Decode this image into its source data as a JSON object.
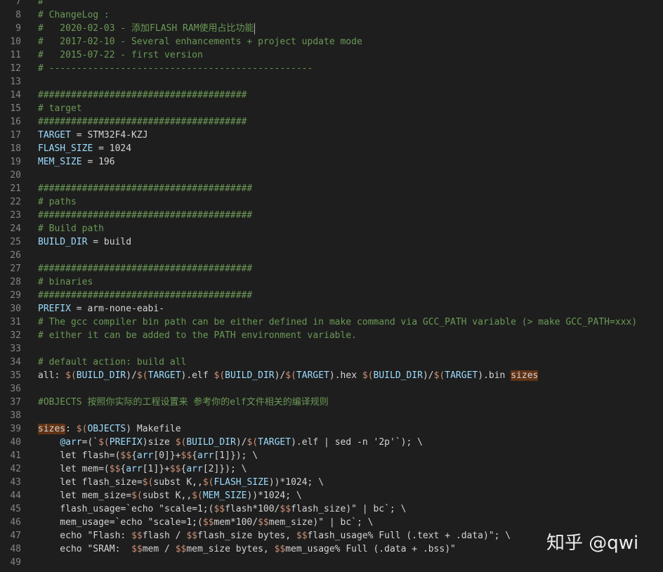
{
  "watermark": "知乎 @qwi",
  "lines": [
    {
      "n": "7",
      "segs": [
        [
          "#",
          "c"
        ]
      ]
    },
    {
      "n": "8",
      "segs": [
        [
          "# ChangeLog :",
          "c"
        ]
      ]
    },
    {
      "n": "9",
      "segs": [
        [
          "#   2020-02-03 - 添加FLASH RAM使用占比功能",
          "c"
        ]
      ],
      "cursor": true
    },
    {
      "n": "10",
      "segs": [
        [
          "#   2017-02-10 - Several enhancements + project update mode",
          "c"
        ]
      ]
    },
    {
      "n": "11",
      "segs": [
        [
          "#   2015-07-22 - first version",
          "c"
        ]
      ]
    },
    {
      "n": "12",
      "segs": [
        [
          "# ------------------------------------------------",
          "c"
        ]
      ]
    },
    {
      "n": "13",
      "segs": []
    },
    {
      "n": "14",
      "segs": [
        [
          "######################################",
          "c"
        ]
      ]
    },
    {
      "n": "15",
      "segs": [
        [
          "# target",
          "c"
        ]
      ]
    },
    {
      "n": "16",
      "segs": [
        [
          "######################################",
          "c"
        ]
      ]
    },
    {
      "n": "17",
      "segs": [
        [
          "TARGET",
          "v"
        ],
        [
          " = STM32F4-KZJ",
          ""
        ]
      ]
    },
    {
      "n": "18",
      "segs": [
        [
          "FLASH_SIZE",
          "v"
        ],
        [
          " = 1024",
          ""
        ]
      ]
    },
    {
      "n": "19",
      "segs": [
        [
          "MEM_SIZE",
          "v"
        ],
        [
          " = 196",
          ""
        ]
      ]
    },
    {
      "n": "20",
      "segs": []
    },
    {
      "n": "21",
      "segs": [
        [
          "#######################################",
          "c"
        ]
      ]
    },
    {
      "n": "22",
      "segs": [
        [
          "# paths",
          "c"
        ]
      ]
    },
    {
      "n": "23",
      "segs": [
        [
          "#######################################",
          "c"
        ]
      ]
    },
    {
      "n": "24",
      "segs": [
        [
          "# Build path",
          "c"
        ]
      ]
    },
    {
      "n": "25",
      "segs": [
        [
          "BUILD_DIR",
          "v"
        ],
        [
          " = build",
          ""
        ]
      ]
    },
    {
      "n": "26",
      "segs": []
    },
    {
      "n": "27",
      "segs": [
        [
          "#######################################",
          "c"
        ]
      ]
    },
    {
      "n": "28",
      "segs": [
        [
          "# binaries",
          "c"
        ]
      ]
    },
    {
      "n": "29",
      "segs": [
        [
          "#######################################",
          "c"
        ]
      ]
    },
    {
      "n": "30",
      "segs": [
        [
          "PREFIX",
          "v"
        ],
        [
          " = arm-none-eabi-",
          ""
        ]
      ]
    },
    {
      "n": "31",
      "segs": [
        [
          "# The gcc compiler bin path can be either defined in make command via GCC_PATH variable (> make GCC_PATH=xxx)",
          "c"
        ]
      ]
    },
    {
      "n": "32",
      "segs": [
        [
          "# either it can be added to the PATH environment variable.",
          "c"
        ]
      ]
    },
    {
      "n": "33",
      "segs": []
    },
    {
      "n": "34",
      "segs": [
        [
          "# default action: build all",
          "c"
        ]
      ]
    },
    {
      "n": "35",
      "segs": [
        [
          "all",
          ""
        ],
        [
          ": ",
          ""
        ],
        [
          "$(",
          "s"
        ],
        [
          "BUILD_DIR",
          "v"
        ],
        [
          ")",
          ""
        ],
        [
          "/",
          ""
        ],
        [
          "$(",
          "s"
        ],
        [
          "TARGET",
          "v"
        ],
        [
          ")",
          ""
        ],
        [
          ".elf ",
          ""
        ],
        [
          "$(",
          "s"
        ],
        [
          "BUILD_DIR",
          "v"
        ],
        [
          ")",
          ""
        ],
        [
          "/",
          ""
        ],
        [
          "$(",
          "s"
        ],
        [
          "TARGET",
          "v"
        ],
        [
          ")",
          ""
        ],
        [
          ".hex ",
          ""
        ],
        [
          "$(",
          "s"
        ],
        [
          "BUILD_DIR",
          "v"
        ],
        [
          ")",
          ""
        ],
        [
          "/",
          ""
        ],
        [
          "$(",
          "s"
        ],
        [
          "TARGET",
          "v"
        ],
        [
          ")",
          ""
        ],
        [
          ".bin ",
          ""
        ],
        [
          "sizes",
          "hl"
        ]
      ]
    },
    {
      "n": "36",
      "segs": []
    },
    {
      "n": "37",
      "segs": [
        [
          "#OBJECTS 按照你实际的工程设置来 参考你的elf文件相关的编译规则",
          "c"
        ]
      ]
    },
    {
      "n": "38",
      "segs": []
    },
    {
      "n": "39",
      "segs": [
        [
          "sizes",
          "hl"
        ],
        [
          ": ",
          ""
        ],
        [
          "$(",
          "s"
        ],
        [
          "OBJECTS",
          "v"
        ],
        [
          ")",
          ""
        ],
        [
          " Makefile",
          ""
        ]
      ]
    },
    {
      "n": "40",
      "segs": [
        [
          "    ",
          ""
        ],
        [
          "@arr",
          "v"
        ],
        [
          "=(`",
          ""
        ],
        [
          "$(",
          "s"
        ],
        [
          "PREFIX",
          "v"
        ],
        [
          ")",
          ""
        ],
        [
          "size ",
          ""
        ],
        [
          "$(",
          "s"
        ],
        [
          "BUILD_DIR",
          "v"
        ],
        [
          ")",
          ""
        ],
        [
          "/",
          ""
        ],
        [
          "$(",
          "s"
        ],
        [
          "TARGET",
          "v"
        ],
        [
          ")",
          ""
        ],
        [
          ".elf | sed -n '2p'`); \\",
          ""
        ]
      ]
    },
    {
      "n": "41",
      "segs": [
        [
          "    let flash=(",
          ""
        ],
        [
          "$$",
          "s"
        ],
        [
          "{",
          ""
        ],
        [
          "arr",
          "v"
        ],
        [
          "[0]}+",
          ""
        ],
        [
          "$$",
          "s"
        ],
        [
          "{",
          ""
        ],
        [
          "arr",
          "v"
        ],
        [
          "[1]}); \\",
          ""
        ]
      ]
    },
    {
      "n": "42",
      "segs": [
        [
          "    let mem=(",
          ""
        ],
        [
          "$$",
          "s"
        ],
        [
          "{",
          ""
        ],
        [
          "arr",
          "v"
        ],
        [
          "[1]}+",
          ""
        ],
        [
          "$$",
          "s"
        ],
        [
          "{",
          ""
        ],
        [
          "arr",
          "v"
        ],
        [
          "[2]}); \\",
          ""
        ]
      ]
    },
    {
      "n": "43",
      "segs": [
        [
          "    let flash_size=",
          ""
        ],
        [
          "$(",
          "s"
        ],
        [
          "subst K,,",
          ""
        ],
        [
          "$(",
          "s"
        ],
        [
          "FLASH_SIZE",
          "v"
        ],
        [
          "))*1024; \\",
          ""
        ]
      ]
    },
    {
      "n": "44",
      "segs": [
        [
          "    let mem_size=",
          ""
        ],
        [
          "$(",
          "s"
        ],
        [
          "subst K,,",
          ""
        ],
        [
          "$(",
          "s"
        ],
        [
          "MEM_SIZE",
          "v"
        ],
        [
          "))*1024; \\",
          ""
        ]
      ]
    },
    {
      "n": "45",
      "segs": [
        [
          "    flash_usage=`echo \"scale=1;(",
          ""
        ],
        [
          "$$",
          "s"
        ],
        [
          "flash*100/",
          ""
        ],
        [
          "$$",
          "s"
        ],
        [
          "flash_size)\" | bc`; \\",
          ""
        ]
      ]
    },
    {
      "n": "46",
      "segs": [
        [
          "    mem_usage=`echo \"scale=1;(",
          ""
        ],
        [
          "$$",
          "s"
        ],
        [
          "mem*100/",
          ""
        ],
        [
          "$$",
          "s"
        ],
        [
          "mem_size)\" | bc`; \\",
          ""
        ]
      ]
    },
    {
      "n": "47",
      "segs": [
        [
          "    echo \"Flash: ",
          ""
        ],
        [
          "$$",
          "s"
        ],
        [
          "flash / ",
          ""
        ],
        [
          "$$",
          "s"
        ],
        [
          "flash_size bytes, ",
          ""
        ],
        [
          "$$",
          "s"
        ],
        [
          "flash_usage% Full (.text + .data)\"; \\",
          ""
        ]
      ]
    },
    {
      "n": "48",
      "segs": [
        [
          "    echo \"SRAM:  ",
          ""
        ],
        [
          "$$",
          "s"
        ],
        [
          "mem / ",
          ""
        ],
        [
          "$$",
          "s"
        ],
        [
          "mem_size bytes, ",
          ""
        ],
        [
          "$$",
          "s"
        ],
        [
          "mem_usage% Full (.data + .bss)\"",
          ""
        ]
      ]
    },
    {
      "n": "49",
      "segs": []
    }
  ]
}
